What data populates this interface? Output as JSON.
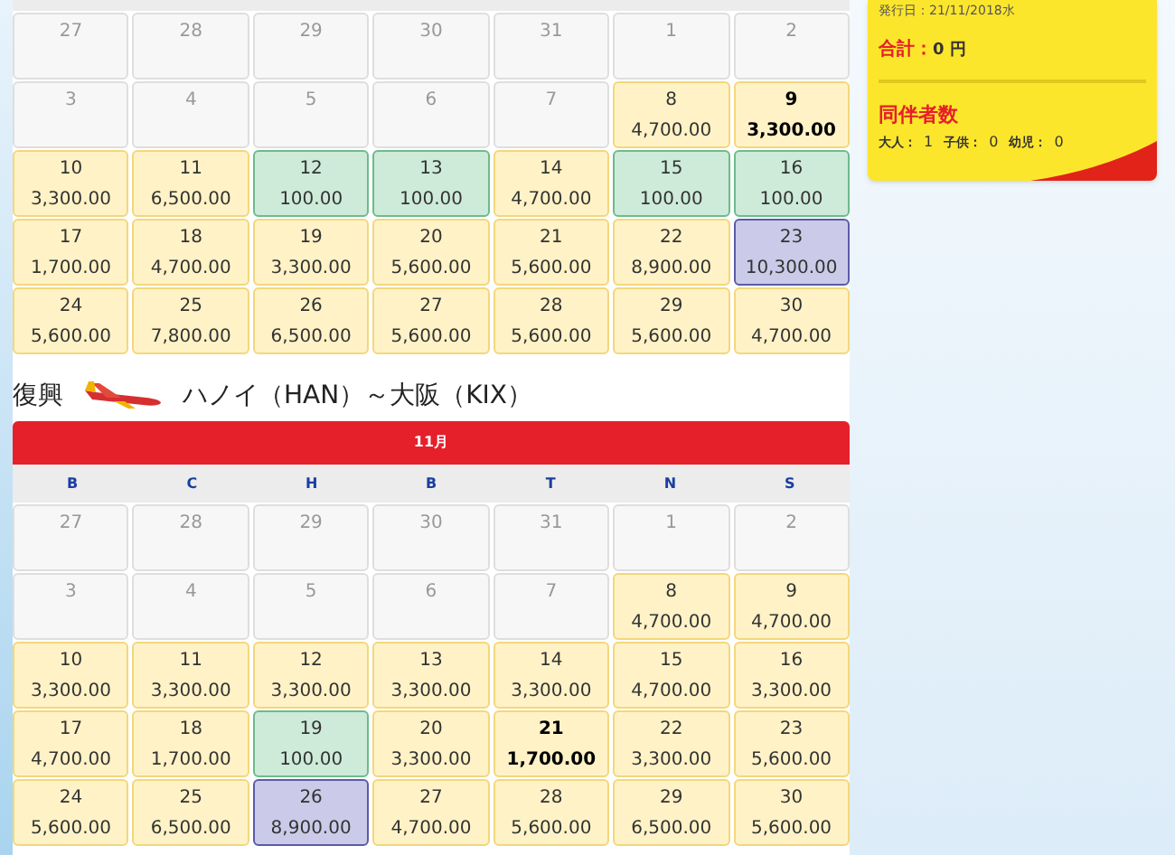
{
  "calendars": [
    {
      "weeks": [
        [
          {
            "day": "27",
            "kind": "off",
            "selected": false
          },
          {
            "day": "28",
            "kind": "off",
            "selected": false
          },
          {
            "day": "29",
            "kind": "off",
            "selected": false
          },
          {
            "day": "30",
            "kind": "off",
            "selected": false
          },
          {
            "day": "31",
            "kind": "off",
            "selected": false
          },
          {
            "day": "1",
            "kind": "off",
            "selected": false
          },
          {
            "day": "2",
            "kind": "off",
            "selected": false
          }
        ],
        [
          {
            "day": "3",
            "kind": "off",
            "selected": false
          },
          {
            "day": "4",
            "kind": "off",
            "selected": false
          },
          {
            "day": "5",
            "kind": "off",
            "selected": false
          },
          {
            "day": "6",
            "kind": "off",
            "selected": false
          },
          {
            "day": "7",
            "kind": "off",
            "selected": false
          },
          {
            "day": "8",
            "price": "4,700.00",
            "kind": "normal",
            "selected": false
          },
          {
            "day": "9",
            "price": "3,300.00",
            "kind": "normal",
            "selected": true
          }
        ],
        [
          {
            "day": "10",
            "price": "3,300.00",
            "kind": "normal",
            "selected": false
          },
          {
            "day": "11",
            "price": "6,500.00",
            "kind": "normal",
            "selected": false
          },
          {
            "day": "12",
            "price": "100.00",
            "kind": "low",
            "selected": false
          },
          {
            "day": "13",
            "price": "100.00",
            "kind": "low",
            "selected": false
          },
          {
            "day": "14",
            "price": "4,700.00",
            "kind": "normal",
            "selected": false
          },
          {
            "day": "15",
            "price": "100.00",
            "kind": "low",
            "selected": false
          },
          {
            "day": "16",
            "price": "100.00",
            "kind": "low",
            "selected": false
          }
        ],
        [
          {
            "day": "17",
            "price": "1,700.00",
            "kind": "normal",
            "selected": false
          },
          {
            "day": "18",
            "price": "4,700.00",
            "kind": "normal",
            "selected": false
          },
          {
            "day": "19",
            "price": "3,300.00",
            "kind": "normal",
            "selected": false
          },
          {
            "day": "20",
            "price": "5,600.00",
            "kind": "normal",
            "selected": false
          },
          {
            "day": "21",
            "price": "5,600.00",
            "kind": "normal",
            "selected": false
          },
          {
            "day": "22",
            "price": "8,900.00",
            "kind": "normal",
            "selected": false
          },
          {
            "day": "23",
            "price": "10,300.00",
            "kind": "high",
            "selected": false
          }
        ],
        [
          {
            "day": "24",
            "price": "5,600.00",
            "kind": "normal",
            "selected": false
          },
          {
            "day": "25",
            "price": "7,800.00",
            "kind": "normal",
            "selected": false
          },
          {
            "day": "26",
            "price": "6,500.00",
            "kind": "normal",
            "selected": false
          },
          {
            "day": "27",
            "price": "5,600.00",
            "kind": "normal",
            "selected": false
          },
          {
            "day": "28",
            "price": "5,600.00",
            "kind": "normal",
            "selected": false
          },
          {
            "day": "29",
            "price": "5,600.00",
            "kind": "normal",
            "selected": false
          },
          {
            "day": "30",
            "price": "4,700.00",
            "kind": "normal",
            "selected": false
          }
        ]
      ]
    },
    {
      "route": {
        "direction": "復興",
        "text": "ハノイ（HAN）～大阪（KIX）"
      },
      "month": "11月",
      "weekdays": [
        "B",
        "C",
        "H",
        "B",
        "T",
        "N",
        "S"
      ],
      "weeks": [
        [
          {
            "day": "27",
            "kind": "off",
            "selected": false
          },
          {
            "day": "28",
            "kind": "off",
            "selected": false
          },
          {
            "day": "29",
            "kind": "off",
            "selected": false
          },
          {
            "day": "30",
            "kind": "off",
            "selected": false
          },
          {
            "day": "31",
            "kind": "off",
            "selected": false
          },
          {
            "day": "1",
            "kind": "off",
            "selected": false
          },
          {
            "day": "2",
            "kind": "off",
            "selected": false
          }
        ],
        [
          {
            "day": "3",
            "kind": "off",
            "selected": false
          },
          {
            "day": "4",
            "kind": "off",
            "selected": false
          },
          {
            "day": "5",
            "kind": "off",
            "selected": false
          },
          {
            "day": "6",
            "kind": "off",
            "selected": false
          },
          {
            "day": "7",
            "kind": "off",
            "selected": false
          },
          {
            "day": "8",
            "price": "4,700.00",
            "kind": "normal",
            "selected": false
          },
          {
            "day": "9",
            "price": "4,700.00",
            "kind": "normal",
            "selected": false
          }
        ],
        [
          {
            "day": "10",
            "price": "3,300.00",
            "kind": "normal",
            "selected": false
          },
          {
            "day": "11",
            "price": "3,300.00",
            "kind": "normal",
            "selected": false
          },
          {
            "day": "12",
            "price": "3,300.00",
            "kind": "normal",
            "selected": false
          },
          {
            "day": "13",
            "price": "3,300.00",
            "kind": "normal",
            "selected": false
          },
          {
            "day": "14",
            "price": "3,300.00",
            "kind": "normal",
            "selected": false
          },
          {
            "day": "15",
            "price": "4,700.00",
            "kind": "normal",
            "selected": false
          },
          {
            "day": "16",
            "price": "3,300.00",
            "kind": "normal",
            "selected": false
          }
        ],
        [
          {
            "day": "17",
            "price": "4,700.00",
            "kind": "normal",
            "selected": false
          },
          {
            "day": "18",
            "price": "1,700.00",
            "kind": "normal",
            "selected": false
          },
          {
            "day": "19",
            "price": "100.00",
            "kind": "low",
            "selected": false
          },
          {
            "day": "20",
            "price": "3,300.00",
            "kind": "normal",
            "selected": false
          },
          {
            "day": "21",
            "price": "1,700.00",
            "kind": "normal",
            "selected": true
          },
          {
            "day": "22",
            "price": "3,300.00",
            "kind": "normal",
            "selected": false
          },
          {
            "day": "23",
            "price": "5,600.00",
            "kind": "normal",
            "selected": false
          }
        ],
        [
          {
            "day": "24",
            "price": "5,600.00",
            "kind": "normal",
            "selected": false
          },
          {
            "day": "25",
            "price": "6,500.00",
            "kind": "normal",
            "selected": false
          },
          {
            "day": "26",
            "price": "8,900.00",
            "kind": "high",
            "selected": false
          },
          {
            "day": "27",
            "price": "4,700.00",
            "kind": "normal",
            "selected": false
          },
          {
            "day": "28",
            "price": "5,600.00",
            "kind": "normal",
            "selected": false
          },
          {
            "day": "29",
            "price": "6,500.00",
            "kind": "normal",
            "selected": false
          },
          {
            "day": "30",
            "price": "5,600.00",
            "kind": "normal",
            "selected": false
          }
        ]
      ]
    }
  ],
  "summary": {
    "issue_date": "発行日：21/11/2018水",
    "total_label": "合計：",
    "total_value": "0 円",
    "companions_title": "同伴者数",
    "companions": [
      {
        "label": "大人：",
        "value": "1"
      },
      {
        "label": "子供：",
        "value": "0"
      },
      {
        "label": "幼児：",
        "value": "0"
      }
    ]
  }
}
